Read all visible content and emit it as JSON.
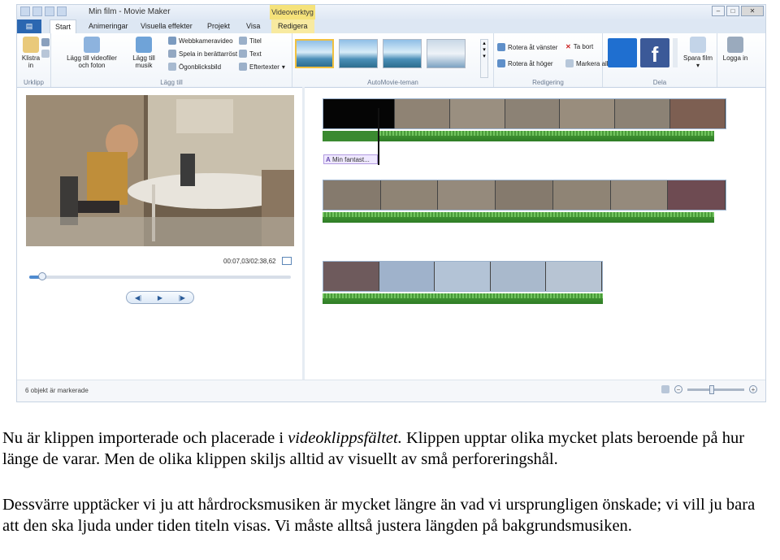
{
  "window": {
    "title": "Min film - Movie Maker",
    "context_header": "Videoverktyg",
    "buttons": [
      "–",
      "□",
      "✕"
    ]
  },
  "tabs": [
    "Start",
    "Animeringar",
    "Visuella effekter",
    "Projekt",
    "Visa",
    "Redigera"
  ],
  "ribbon": {
    "clipboard": {
      "paste": "Klistra in",
      "label": "Urklipp"
    },
    "add": {
      "add_videos": "Lägg till videofiler och foton",
      "add_music": "Lägg till musik",
      "webcam": "Webbkameravideo",
      "narration": "Spela in berättarröst",
      "snapshot": "Ögonblicksbild",
      "title": "Titel",
      "text": "Text",
      "credits": "Eftertexter",
      "label": "Lägg till"
    },
    "themes": {
      "label": "AutoMovie-teman"
    },
    "edit": {
      "rotate_left": "Rotera åt vänster",
      "remove": "Ta bort",
      "rotate_right": "Rotera åt höger",
      "select_all": "Markera alla",
      "label": "Redigering"
    },
    "share": {
      "share_movie": "Spara film",
      "label": "Dela"
    },
    "signin": {
      "label": "Logga in"
    }
  },
  "preview": {
    "timecode": "00:07,03/02:38,62",
    "progress": 0.05
  },
  "storyboard": {
    "caption_tag": "Min fantast..."
  },
  "status": {
    "selection": "6 objekt är markerade"
  },
  "paragraphs": {
    "p1_a": "Nu är klippen importerade och placerade i ",
    "p1_em": "videoklippsfältet.",
    "p1_b": " Klippen upptar olika mycket plats beroende på hur länge de varar. Men de olika klippen skiljs alltid av visuellt av små perforeringshål.",
    "p2": "Dessvärre upptäcker vi ju att hårdrocksmusiken är mycket längre än vad vi ursprungligen önskade; vi vill ju bara att den ska ljuda under tiden titeln visas. Vi måste alltså justera längden på bakgrundsmusiken."
  },
  "colors": {
    "accent": "#2b67b1",
    "context": "#f5e27a",
    "audio": "#3d8f30"
  }
}
